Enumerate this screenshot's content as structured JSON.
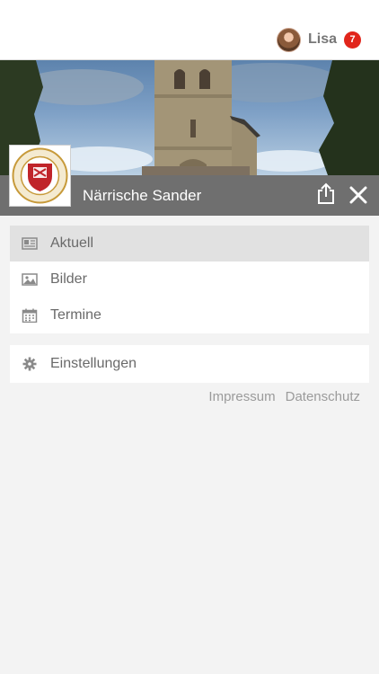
{
  "user": {
    "name": "Lisa",
    "notification_count": "7",
    "badge_color": "#e1251b"
  },
  "header": {
    "club_name": "Närrische Sander",
    "bar_color": "#6f6f6f",
    "logo_text_top": "KG NÄRRISCHE SANDER",
    "logo_text_bottom": "1953 e.V."
  },
  "menu": {
    "main_items": [
      {
        "label": "Aktuell",
        "icon": "newspaper-icon",
        "active": true
      },
      {
        "label": "Bilder",
        "icon": "image-icon",
        "active": false
      },
      {
        "label": "Termine",
        "icon": "calendar-icon",
        "active": false
      }
    ],
    "secondary_items": [
      {
        "label": "Einstellungen",
        "icon": "gear-icon",
        "active": false
      }
    ]
  },
  "footer": {
    "impressum": "Impressum",
    "datenschutz": "Datenschutz"
  },
  "icons": {
    "share": "share-icon",
    "close": "close-icon"
  }
}
